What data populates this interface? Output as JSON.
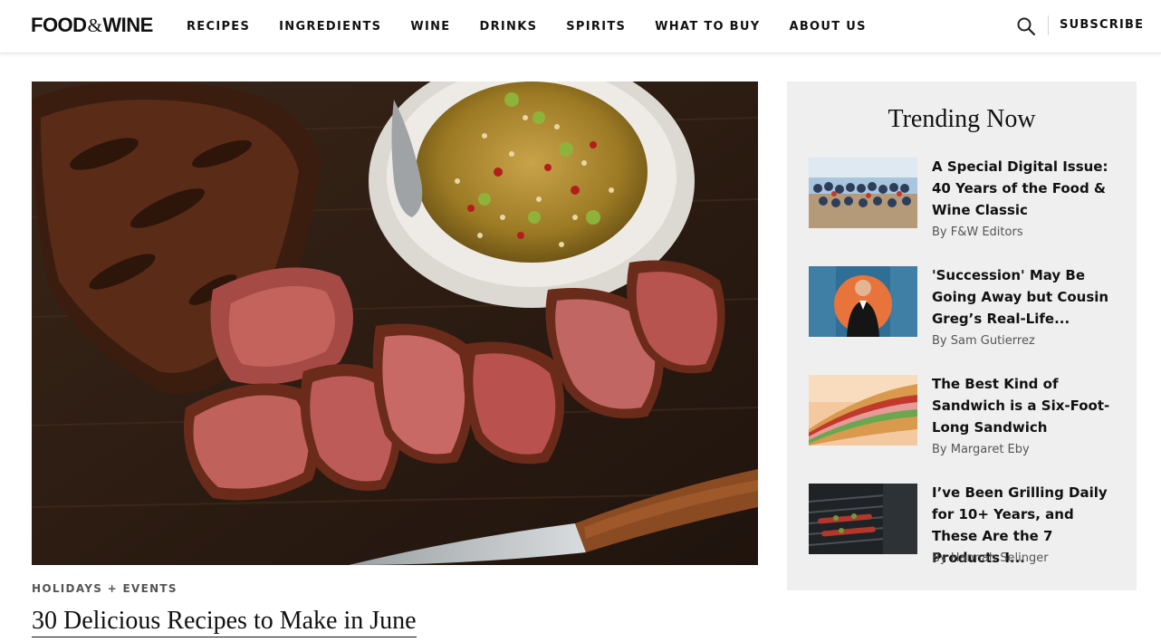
{
  "header": {
    "logo": {
      "part1": "FOOD",
      "amp": "&",
      "part2": "WINE"
    },
    "nav": [
      "RECIPES",
      "INGREDIENTS",
      "WINE",
      "DRINKS",
      "SPIRITS",
      "WHAT TO BUY",
      "ABOUT US"
    ],
    "search_icon": "search-icon",
    "subscribe_label": "SUBSCRIBE"
  },
  "hero": {
    "tag": "HOLIDAYS + EVENTS",
    "title": "30 Delicious Recipes to Make in June",
    "image": "sliced-grilled-steak-with-chili-sauce"
  },
  "trending": {
    "title": "Trending Now",
    "items": [
      {
        "headline": "A Special Digital Issue: 40 Years of the Food & Wine Classic",
        "byline": "By F&W Editors",
        "thumb": "crowd-group-photo"
      },
      {
        "headline": "'Succession' May Be Going Away but Cousin Greg’s Real-Life...",
        "byline": "By Sam Gutierrez",
        "thumb": "man-in-tuxedo-portrait"
      },
      {
        "headline": "The Best Kind of Sandwich is a Six-Foot-Long Sandwich",
        "byline": "By Margaret Eby",
        "thumb": "long-sandwich"
      },
      {
        "headline": "I’ve Been Grilling Daily for 10+ Years, and These Are the 7 Products I...",
        "byline": "By Hannah Selinger",
        "thumb": "grill-skewers"
      }
    ]
  },
  "colors": {
    "panel_bg": "#efefef",
    "text": "#111111",
    "muted": "#555555"
  }
}
